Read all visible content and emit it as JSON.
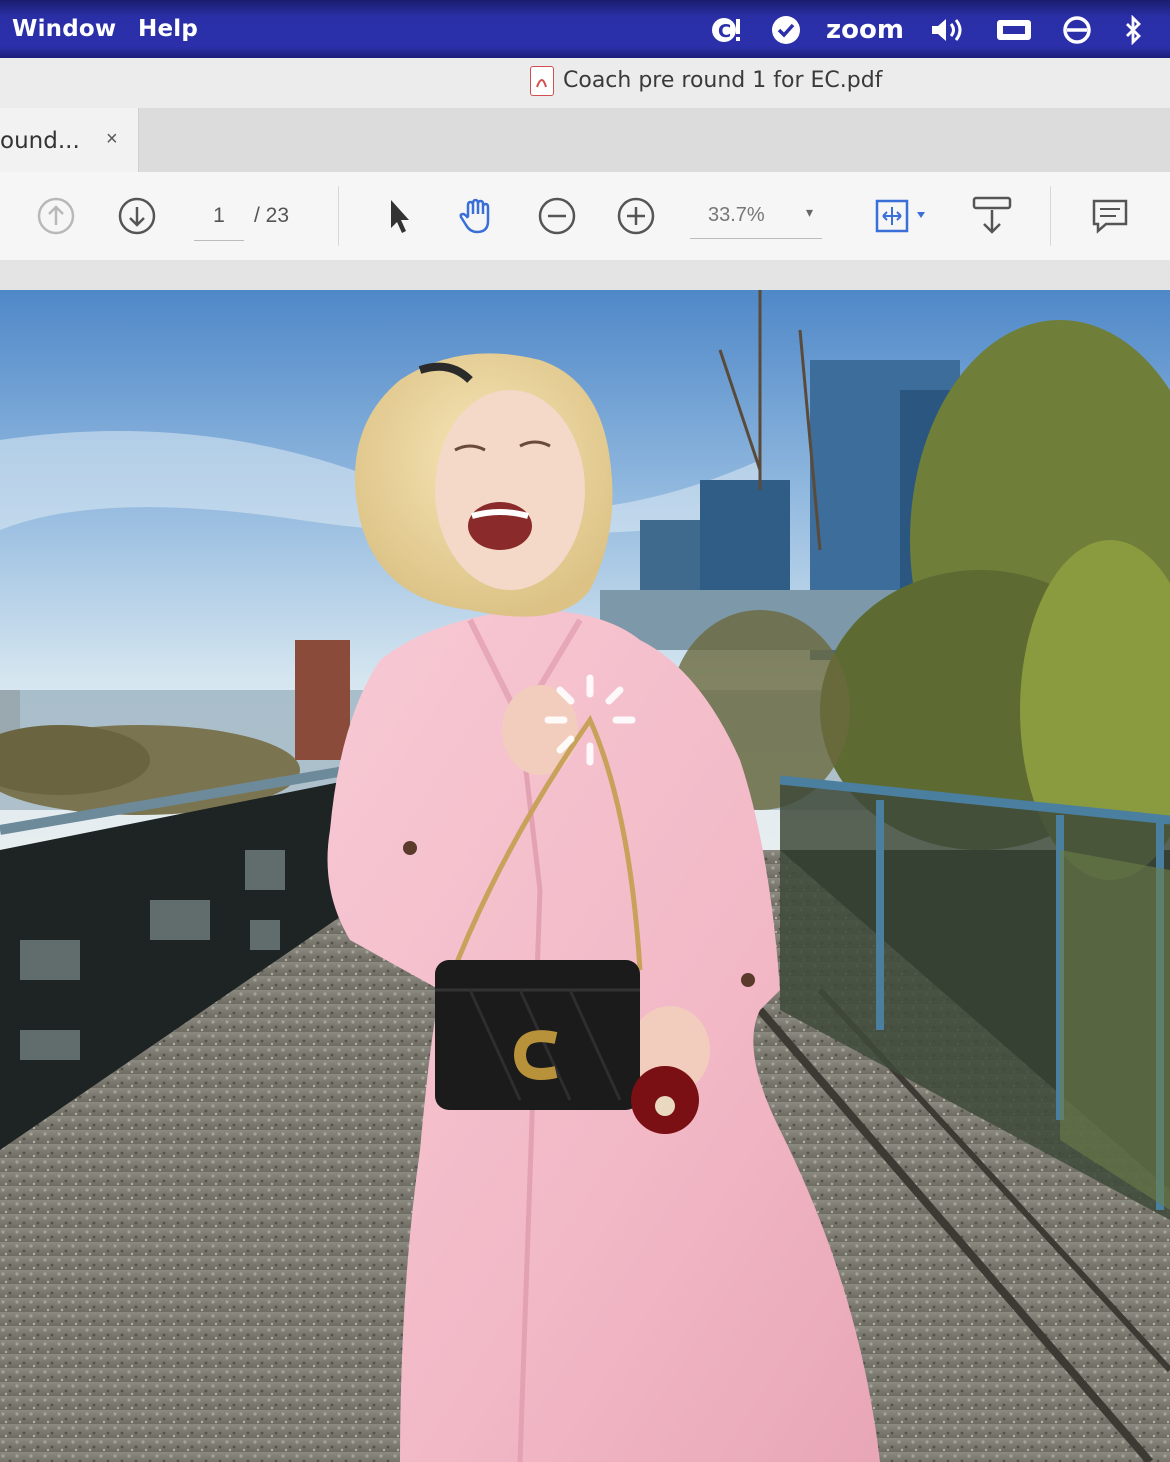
{
  "menubar": {
    "items": [
      "Window",
      "Help"
    ],
    "tray": {
      "zoom_label": "zoom"
    }
  },
  "window": {
    "title": "Coach pre round 1 for EC.pdf"
  },
  "tab": {
    "label": "ound...",
    "close": "×"
  },
  "toolbar": {
    "page_current": "1",
    "page_total": "/ 23",
    "zoom_value": "33.7%",
    "zoom_caret": "▾"
  },
  "colors": {
    "menubar": "#2b30aa",
    "accent_blue": "#3a6fd8",
    "coat_pink": "#f2b8c6"
  }
}
